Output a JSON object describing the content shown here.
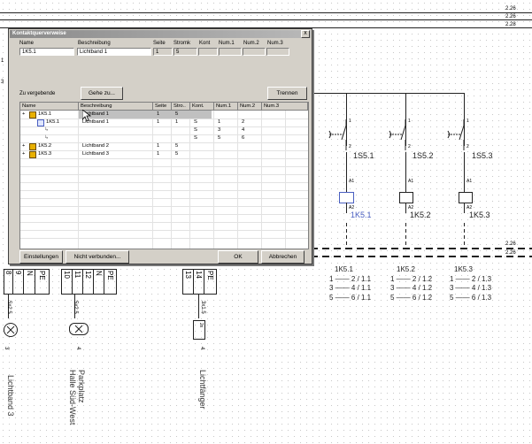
{
  "schematic": {
    "ref_top_1": "2.26",
    "ref_top_2": "2.26",
    "ref_top_3": "2.28",
    "ref_mid_1": "2.26",
    "ref_mid_2": "2.26",
    "ref_left_1": "1",
    "ref_left_2": "3",
    "coils": [
      {
        "switch_label": "1S5.1",
        "coil_label": "1K5.1",
        "pin1": "1",
        "pin2": "2",
        "pin3": "A1",
        "pin4": "A2"
      },
      {
        "switch_label": "1S5.2",
        "coil_label": "1K5.2",
        "pin1": "1",
        "pin2": "2",
        "pin3": "A1",
        "pin4": "A2"
      },
      {
        "switch_label": "1S5.3",
        "coil_label": "1K5.3",
        "pin1": "1",
        "pin2": "2",
        "pin3": "A1",
        "pin4": "A2"
      }
    ],
    "contacts": [
      {
        "title": "1K5.1",
        "rows": [
          "1 —— 2 / 1.1",
          "3 —— 4 / 1.1",
          "5 —— 6 / 1.1"
        ]
      },
      {
        "title": "1K5.2",
        "rows": [
          "1 —— 2 / 1.2",
          "3 —— 4 / 1.2",
          "5 —— 6 / 1.2"
        ]
      },
      {
        "title": "1K5.3",
        "rows": [
          "1 —— 2 / 1.3",
          "3 —— 4 / 1.3",
          "5 —— 6 / 1.3"
        ]
      }
    ],
    "terminals_1": [
      "9",
      "N",
      "PE"
    ],
    "terminals_2": [
      "10",
      "11",
      "N",
      "PE"
    ],
    "terminals_3": [
      "13",
      "14",
      "PE"
    ],
    "terminal_prefix_1": "8",
    "terminal_prefix_2": "12",
    "cable_1": "5x2.5",
    "cable_2": "5x2.5",
    "cable_3": "3x1.5",
    "cable_box_3": "2x",
    "small_num_1": "3",
    "small_num_2": "4",
    "small_num_3": "4",
    "label_1": "Lichtband 3",
    "label_2a": "Parkplatz",
    "label_2b": "Halle Süd-West",
    "label_3": "Lichtfänger"
  },
  "dialog": {
    "title": "Kontaktquerverweise",
    "close": "x",
    "header": {
      "name_label": "Name",
      "beschreibung_label": "Beschreibung",
      "seite_label": "Seite",
      "stromk_label": "Stromk",
      "kont_label": "Kont",
      "num1_label": "Num.1",
      "num2_label": "Num.2",
      "num3_label": "Num.3",
      "name_value": "1K5.1",
      "beschreibung_value": "Lichtband 1",
      "seite_value": "1",
      "stromk_value": "5"
    },
    "zu_vergebende": "Zu vergebende",
    "gehe_zu": "Gehe zu...",
    "trennen": "Trennen",
    "columns": [
      "Name",
      "Beschreibung",
      "Seite",
      "Stro..",
      "Kont.",
      "Num.1",
      "Num.2",
      "Num.3"
    ],
    "rows": [
      {
        "expander": "+",
        "name": "1K5.1",
        "beschreibung": "Lichtband 1",
        "seite": "1",
        "stro": "5",
        "kont": "",
        "num1": "",
        "num2": "",
        "num3": "",
        "level": 0,
        "selected": true
      },
      {
        "expander": "",
        "name": "1K5.1",
        "beschreibung": "Lichtband 1",
        "seite": "1",
        "stro": "1",
        "kont": "S",
        "num1": "1",
        "num2": "2",
        "num3": "",
        "level": 1,
        "selected": false
      },
      {
        "expander": "",
        "name": "",
        "beschreibung": "",
        "seite": "",
        "stro": "",
        "kont": "S",
        "num1": "3",
        "num2": "4",
        "num3": "",
        "level": 2,
        "selected": false
      },
      {
        "expander": "",
        "name": "",
        "beschreibung": "",
        "seite": "",
        "stro": "",
        "kont": "S",
        "num1": "5",
        "num2": "6",
        "num3": "",
        "level": 2,
        "selected": false
      },
      {
        "expander": "+",
        "name": "1K5.2",
        "beschreibung": "Lichtband 2",
        "seite": "1",
        "stro": "5",
        "kont": "",
        "num1": "",
        "num2": "",
        "num3": "",
        "level": 0,
        "selected": false
      },
      {
        "expander": "+",
        "name": "1K5.3",
        "beschreibung": "Lichtband 3",
        "seite": "1",
        "stro": "5",
        "kont": "",
        "num1": "",
        "num2": "",
        "num3": "",
        "level": 0,
        "selected": false
      }
    ],
    "einstellungen": "Einstellungen",
    "nicht_verbunden": "Nicht verbunden...",
    "ok": "OK",
    "abbrechen": "Abbrechen"
  },
  "colors": {
    "accent_blue": "#4a5fc1",
    "dialog_bg": "#d4d0c8",
    "selection": "#c0c0c0"
  }
}
